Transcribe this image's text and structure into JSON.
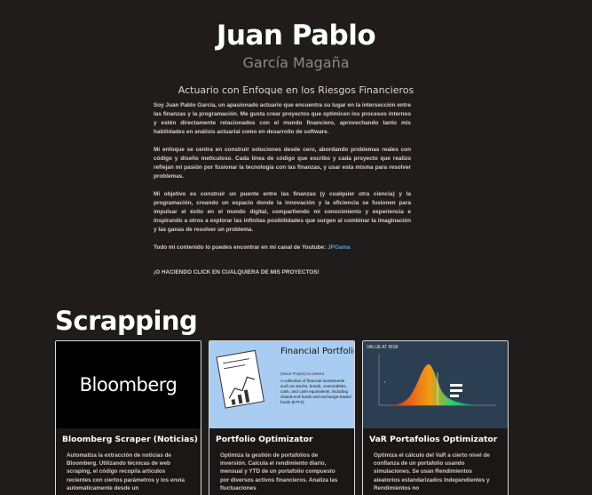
{
  "header": {
    "name": "Juan Pablo",
    "surname": "García Magaña",
    "role": "Actuario con Enfoque en los Riesgos Financieros"
  },
  "bio": {
    "p1": "Soy Juan Pablo García, un apasionado actuario que encuentra su lugar en la intersección entre las finanzas y la programación. Me gusta crear proyectos que optimicen los procesos internos y estén directamente relacionados con el mundo financiero, aprovechando tanto mis habilidades en análisis actuarial como en desarrollo de software.",
    "p2": "Mi enfoque se centra en construir soluciones desde cero, abordando problemas reales con código y diseño meticuloso. Cada línea de código que escribo y cada proyecto que realizo reflejan mi pasión por fusionar la tecnología con las finanzas, y usar esta misma para resolver problemas.",
    "p3": "Mi objetivo es construir un puente entre las finanzas (y cualquier otra ciencia) y la programación, creando un espacio donde la innovación y la eficiencia se fusionen para impulsar el éxito en el mundo digital, compartiendo mi conocimiento y experiencia e inspirando a otros a explorar las infinitas posibilidades que surgen al combinar la imaginación y las ganas de resolver un problema.",
    "youtube_text": "Todo mi contenido lo puedes encontrar en mi canal de Youtube: ",
    "youtube_link": "JPGama",
    "cta": "¡O HACIENDO CLICK EN CUALQUIERA DE MIS PROYECTOS!"
  },
  "section": {
    "title": "Scrapping"
  },
  "cards": [
    {
      "thumb_text": "Bloomberg",
      "title": "Bloomberg Scraper (Noticias)",
      "desc": "Automatiza la extracción de noticias de Bloomberg. Utilizando técnicas de web scraping, el código recopila artículos recientes con ciertos parámetros y los envía automáticamente desde un"
    },
    {
      "thumb_title": "Financial Portfolio",
      "thumb_sub": "(Noun Project) la cartera",
      "thumb_text": "A collection of financial investments such as stocks, bonds, commodities, cash, and cash equivalents, including closed-end funds and exchange-traded funds (ETFs).",
      "title": "Portfolio Optimizator",
      "desc": "Optimiza la gestión de portafolios de inversión. Calcula el rendimiento diario, mensual y YTD de un portafolio compuesto por diversos activos financieros. Analiza las fluctuaciones"
    },
    {
      "thumb_label": "VALUE AT RISK",
      "title": "VaR Portafolios Optimizator",
      "desc": "Optimiza el cálculo del VaR a cierto nivel de confianza de un portafolio usando simulaciones. Se usan Rendimientos aleatorios estandarizados Independientes y Rendimientos no"
    }
  ],
  "colors": {
    "background": "#1f1c1b",
    "link": "#4aa3df",
    "card_blue": "#a9cdf2",
    "card_navy": "#2c3f52"
  }
}
